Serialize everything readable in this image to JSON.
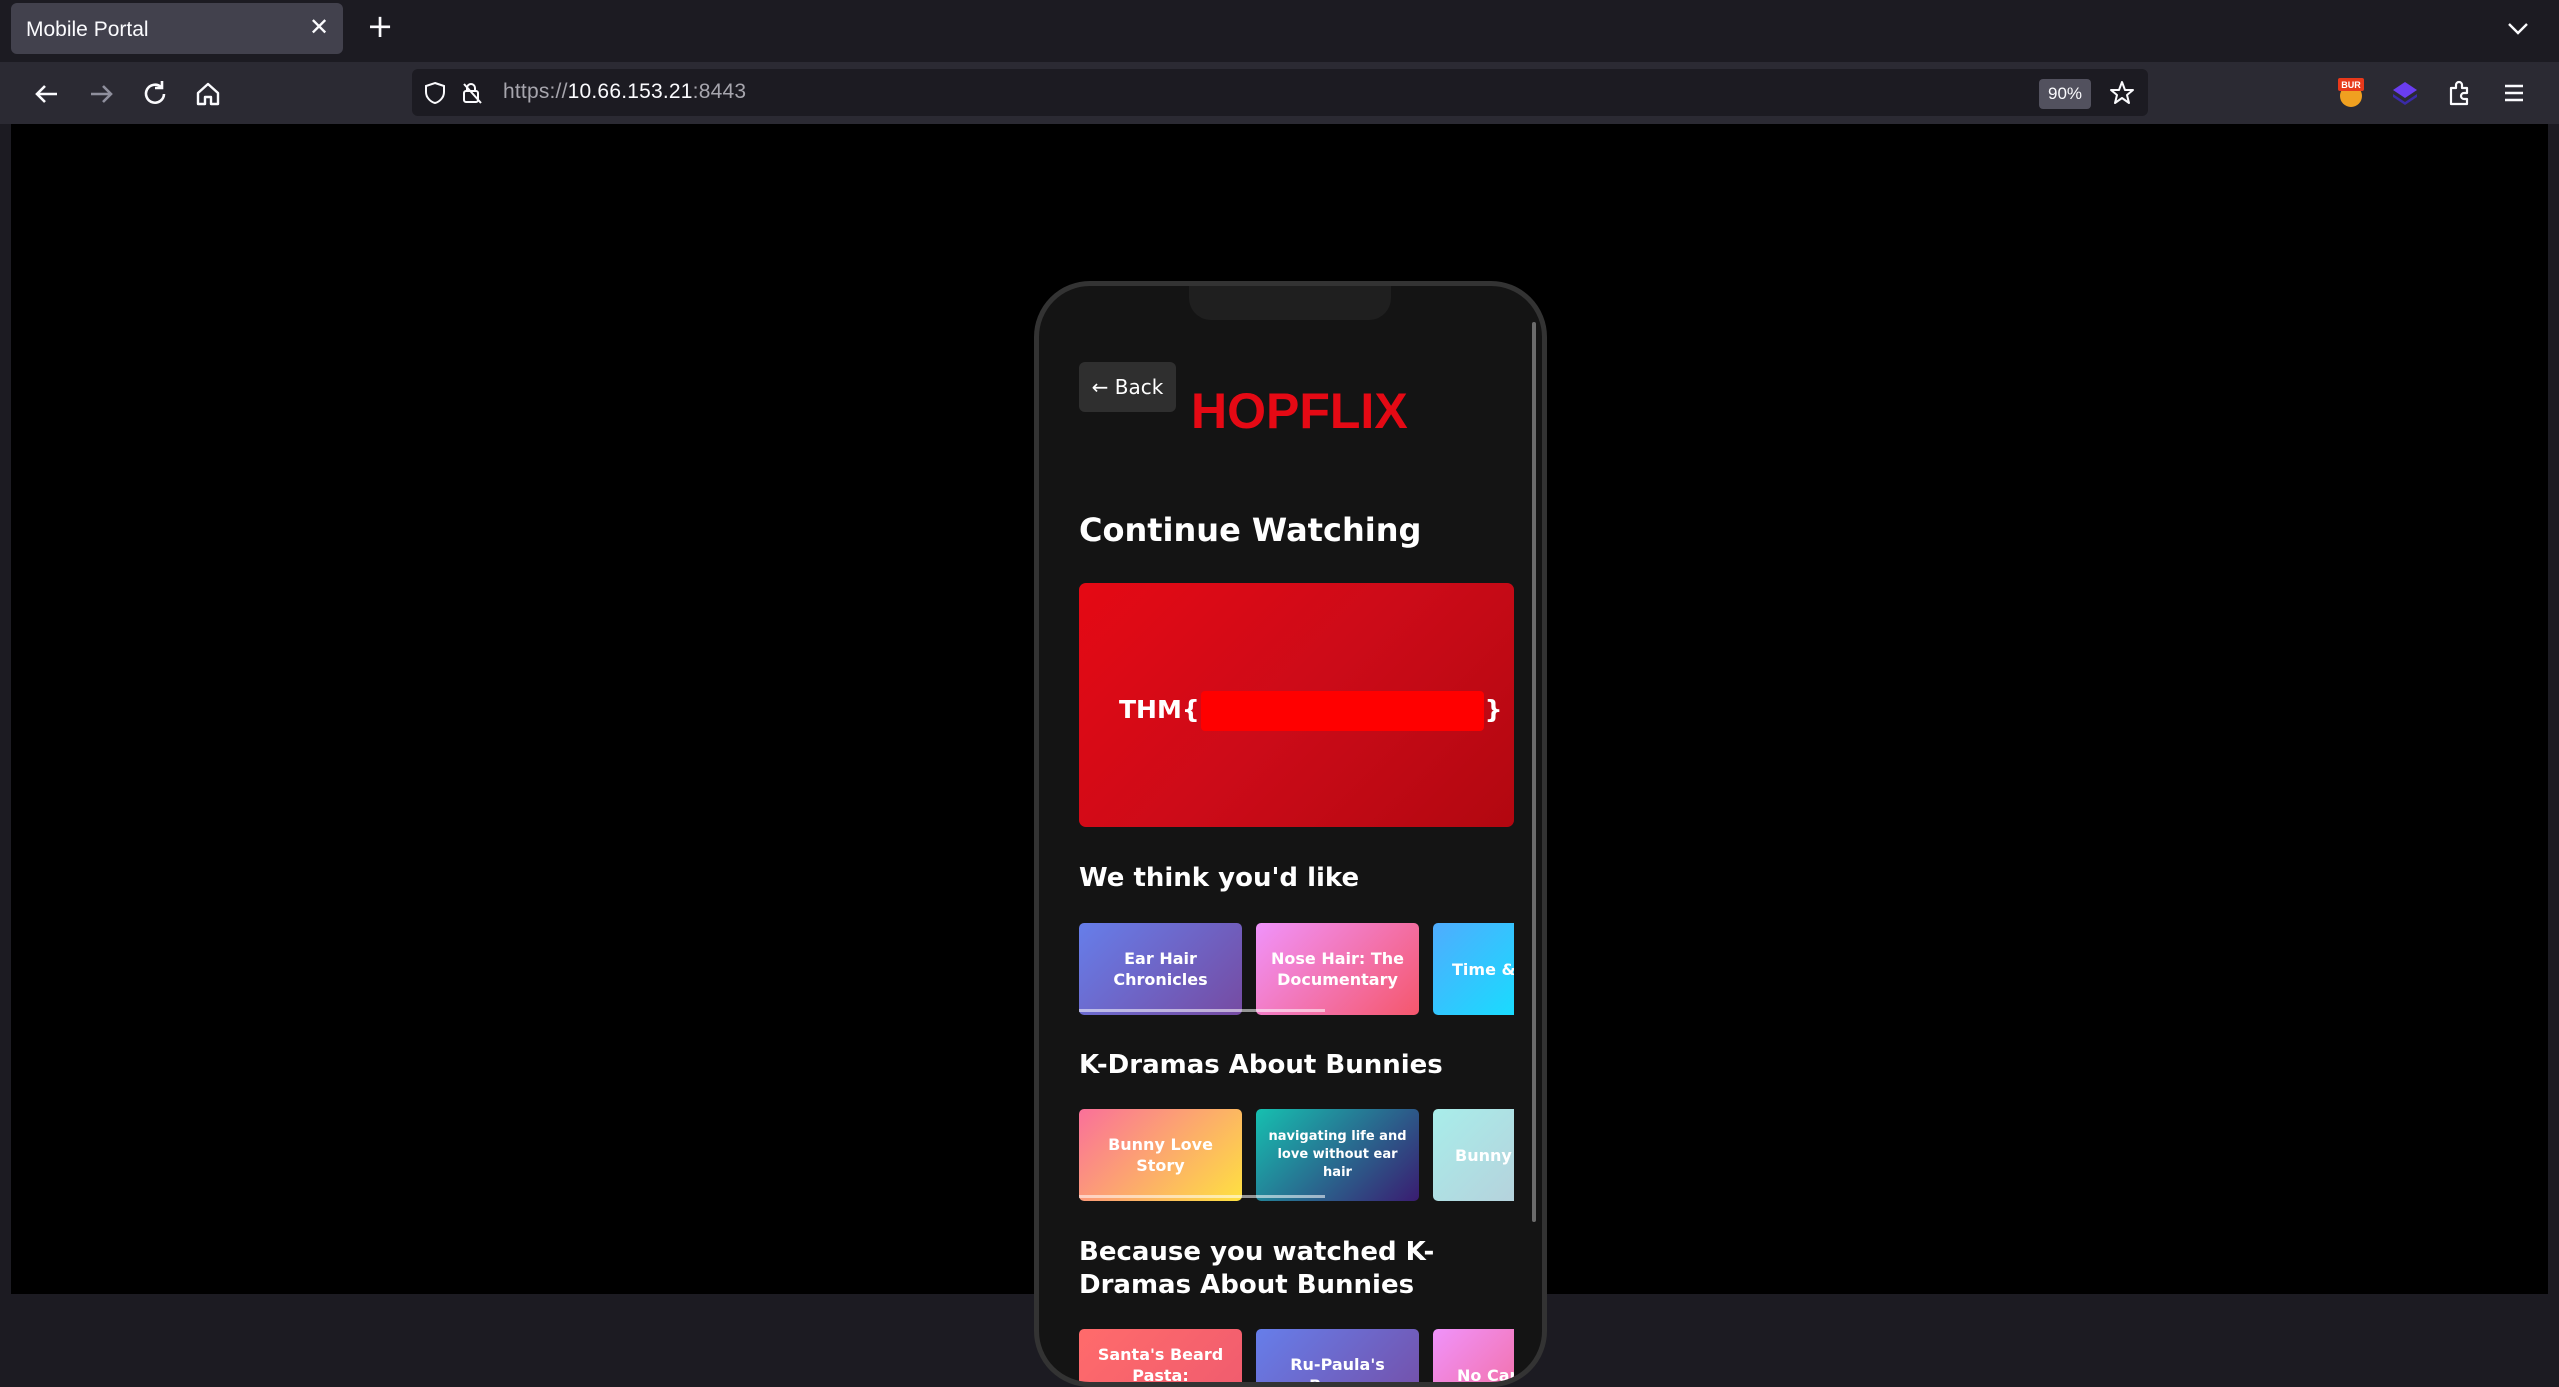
{
  "browser": {
    "tab_title": "Mobile Portal",
    "url_scheme": "https://",
    "url_host": "10.66.153.21",
    "url_port": ":8443",
    "zoom": "90%",
    "extension_badge": "BUR"
  },
  "app": {
    "back_label": "← Back",
    "logo": "HOPFLIX",
    "continue_watching_title": "Continue Watching",
    "flag_prefix": "THM{",
    "flag_suffix": "}",
    "sections": [
      {
        "title": "We think you'd like",
        "cards": [
          {
            "label": "Ear Hair Chronicles"
          },
          {
            "label": "Nose Hair: The Documentary"
          },
          {
            "label": "Time & H"
          }
        ]
      },
      {
        "title": "K-Dramas About Bunnies",
        "cards": [
          {
            "label": "Bunny Love Story"
          },
          {
            "label": "navigating life and love without ear hair"
          },
          {
            "label": "Bunny W"
          }
        ]
      },
      {
        "title": "Because you watched K-Dramas About Bunnies",
        "cards": [
          {
            "label": "Santa's Beard Pasta: Restaurant"
          },
          {
            "label": "Ru-Paula's Bunny"
          },
          {
            "label": "No Cap:"
          }
        ]
      }
    ]
  }
}
